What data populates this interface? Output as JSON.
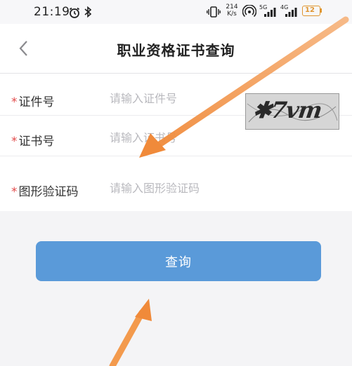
{
  "status_bar": {
    "time": "21:19",
    "network_speed_value": "214",
    "network_speed_unit": "K/s",
    "signal1_label": "5G",
    "signal2_label": "4G",
    "battery_level": "12",
    "icons": [
      "alarm-icon",
      "bluetooth-icon",
      "vibrate-icon",
      "hotspot-icon",
      "signal-icon",
      "battery-icon"
    ]
  },
  "header": {
    "title": "职业资格证书查询"
  },
  "form": {
    "required_mark": "*",
    "fields": [
      {
        "label": "证件号",
        "placeholder": "请输入证件号",
        "value": ""
      },
      {
        "label": "证书号",
        "placeholder": "请输入证书号",
        "value": ""
      },
      {
        "label": "图形验证码",
        "placeholder": "请输入图形验证码",
        "value": ""
      }
    ],
    "captcha_text": "✱7vm"
  },
  "actions": {
    "query_label": "查询"
  },
  "colors": {
    "accent": "#5a9ad9",
    "required": "#e24a4a",
    "annotation_arrow": "#f39a4d"
  }
}
